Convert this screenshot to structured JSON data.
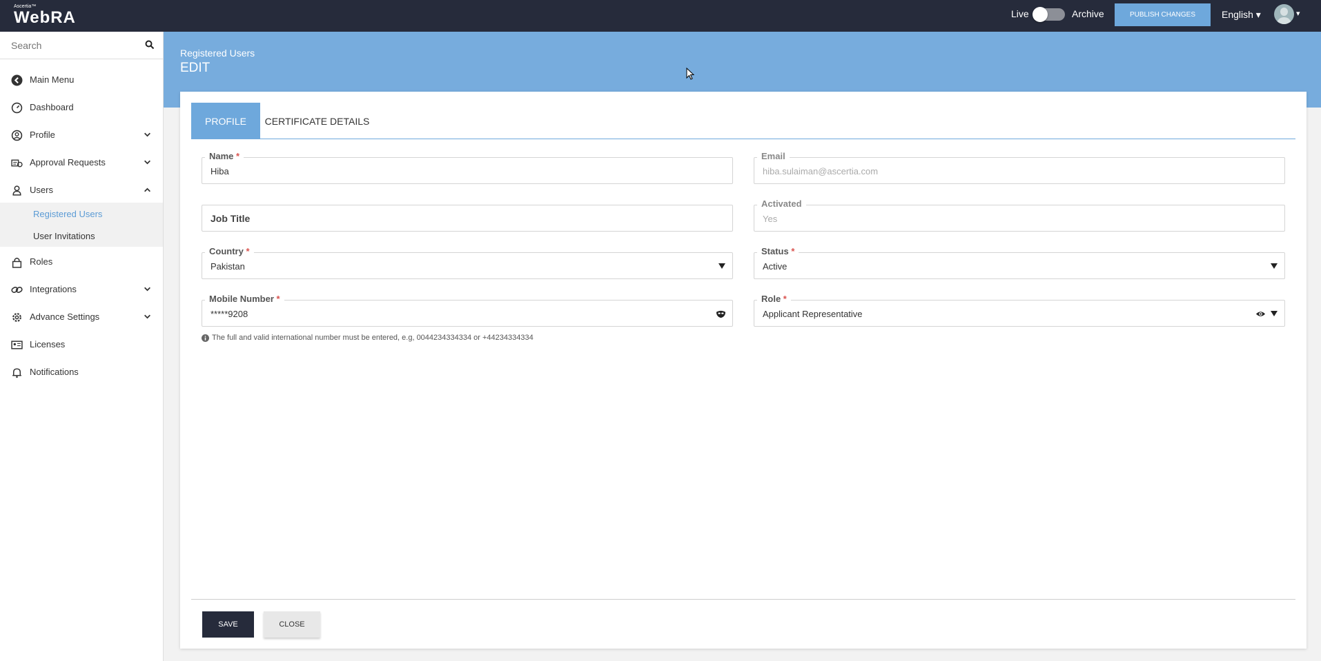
{
  "topbar": {
    "brand_small": "Ascertia™",
    "brand": "WebRA",
    "live_label": "Live",
    "archive_label": "Archive",
    "publish_label": "PUBLISH CHANGES",
    "language": "English ▾",
    "avatar_caret": "▾"
  },
  "sidebar": {
    "search_placeholder": "Search",
    "items": [
      {
        "label": "Main Menu",
        "icon": "back-circle-icon"
      },
      {
        "label": "Dashboard",
        "icon": "gauge-icon"
      },
      {
        "label": "Profile",
        "icon": "user-circle-icon"
      },
      {
        "label": "Approval Requests",
        "icon": "approval-icon"
      },
      {
        "label": "Users",
        "icon": "users-icon"
      },
      {
        "label": "Roles",
        "icon": "lock-icon"
      },
      {
        "label": "Integrations",
        "icon": "link-icon"
      },
      {
        "label": "Advance Settings",
        "icon": "gear-icon"
      },
      {
        "label": "Licenses",
        "icon": "id-card-icon"
      },
      {
        "label": "Notifications",
        "icon": "bell-icon"
      }
    ],
    "users_sub": [
      {
        "label": "Registered Users",
        "active": true
      },
      {
        "label": "User Invitations",
        "active": false
      }
    ]
  },
  "header": {
    "breadcrumb": "Registered Users",
    "title": "EDIT"
  },
  "tabs": [
    {
      "label": "PROFILE",
      "active": true
    },
    {
      "label": "CERTIFICATE DETAILS",
      "active": false
    }
  ],
  "form": {
    "name": {
      "label": "Name",
      "value": "Hiba",
      "required": "*"
    },
    "email": {
      "label": "Email",
      "value": "hiba.sulaiman@ascertia.com"
    },
    "job_title": {
      "label": "Job Title",
      "value": ""
    },
    "activated": {
      "label": "Activated",
      "value": "Yes"
    },
    "country": {
      "label": "Country",
      "value": "Pakistan",
      "required": "*"
    },
    "status": {
      "label": "Status",
      "value": "Active",
      "required": "*"
    },
    "mobile": {
      "label": "Mobile Number",
      "value": "*****9208",
      "required": "*"
    },
    "role": {
      "label": "Role",
      "value": "Applicant Representative",
      "required": "*"
    },
    "mobile_hint": "The full and valid international number must be entered, e.g, 0044234334334 or +44234334334"
  },
  "actions": {
    "save": "SAVE",
    "close": "CLOSE"
  },
  "colors": {
    "topbar": "#262b3b",
    "accent": "#6ea8dc",
    "banner": "#77acdd",
    "active_sub": "#5b9bd5",
    "required": "#d9534f"
  }
}
